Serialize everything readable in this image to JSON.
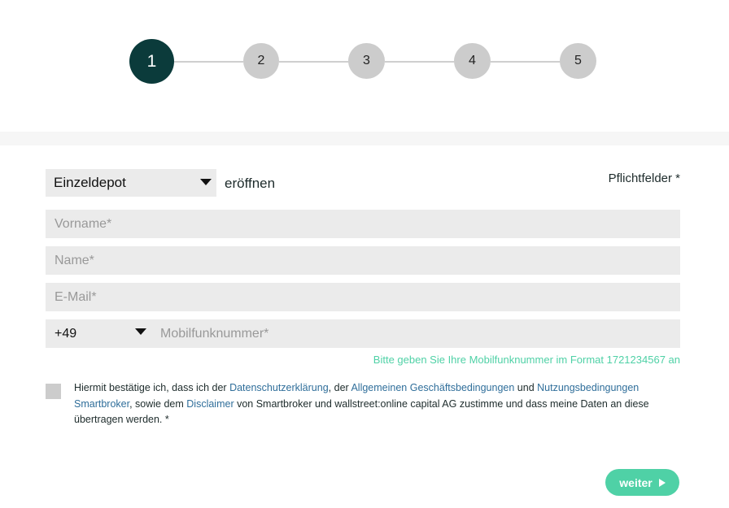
{
  "stepper": {
    "steps": [
      "1",
      "2",
      "3",
      "4",
      "5"
    ],
    "active_step": 1
  },
  "form": {
    "depot_type": {
      "selected": "Einzeldepot"
    },
    "open_label": "eröffnen",
    "required_note": "Pflichtfelder *",
    "firstname": {
      "placeholder": "Vorname*",
      "value": ""
    },
    "lastname": {
      "placeholder": "Name*",
      "value": ""
    },
    "email": {
      "placeholder": "E-Mail*",
      "value": ""
    },
    "phone": {
      "prefix": "+49",
      "placeholder": "Mobilfunknummer*",
      "hint": "Bitte geben Sie Ihre Mobilfunknummer im Format 1721234567 an"
    },
    "consent": {
      "checked": false,
      "t1": "Hiermit bestätige ich, dass ich der ",
      "link1": "Datenschutzerklärung",
      "t2": ", der ",
      "link2": "Allgemeinen Geschäftsbedingungen",
      "t3": " und ",
      "link3": "Nutzungsbedingungen Smartbroker",
      "t4": ", sowie dem ",
      "link4": "Disclaimer",
      "t5": " von Smartbroker und wallstreet:online capital AG zustimme und dass meine Daten an diese übertragen werden. *"
    },
    "submit_label": "weiter"
  },
  "colors": {
    "active_step": "#0b3b3b",
    "inactive_step": "#cccccc",
    "accent": "#4fd1a6",
    "link": "#2f6e9a",
    "field_bg": "#ebebeb"
  }
}
